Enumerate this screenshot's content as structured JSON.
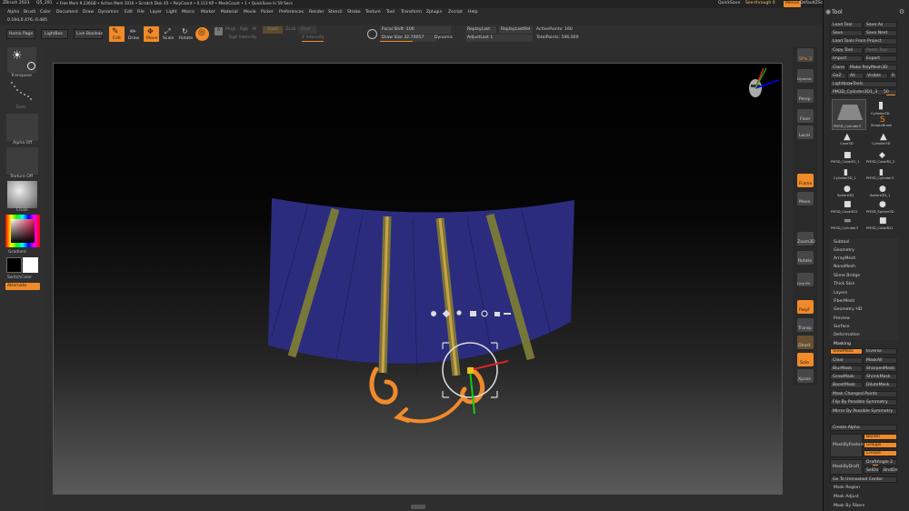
{
  "title_bar": {
    "app": "ZBrush 2023",
    "file": "Q5_291",
    "status": "• Free Mem 9.236GB • Active Mem 1016 • Scratch Disk 45 • PolyCount • 0.112 KP • MeshCount • 1 • QuickSave In 59 Secs",
    "quicksave": "QuickSave",
    "see_through": "See-through  0",
    "menus_btn": "Menus",
    "script": "DefaultZScript"
  },
  "menus": [
    "Alpha",
    "Brush",
    "Color",
    "Document",
    "Draw",
    "Dynamics",
    "Edit",
    "File",
    "Layer",
    "Light",
    "Macro",
    "Marker",
    "Material",
    "Movie",
    "Picker",
    "Preferences",
    "Render",
    "Stencil",
    "Stroke",
    "Texture",
    "Tool",
    "Transform",
    "Zplugin",
    "Zscript",
    "Help"
  ],
  "coords": "0.194,0.476,-0.485",
  "top_shelf": {
    "home_page": "Home Page",
    "lightbox": "LightBox",
    "live_boolean": "Live Boolean",
    "edit": "Edit",
    "draw": "Draw",
    "move": "Move",
    "scale": "Scale",
    "rotate": "Rotate",
    "a_badge": "A",
    "mrgb": "Mrgb",
    "rgb": "Rgb",
    "m": "M",
    "zadd": "Zadd",
    "zsub": "Zsub",
    "zcut": "Zcut",
    "rgb_intensity": "Rgb Intensity",
    "z_intensity": "Z Intensity",
    "focal_shift": "Focal Shift -100",
    "draw_size": "Draw Size 32.70057",
    "dynamic": "Dynamic",
    "replay_last": "ReplayLast",
    "replay_last_rel": "ReplayLastRel",
    "adjust_last": "AdjustLast 1",
    "active_points": "ActivePoints: 160",
    "total_points": "TotalPoints: 596,000"
  },
  "left_tray": {
    "brush_label": "Transpose",
    "stroke_label": "Dots",
    "alpha_label": "Alpha Off",
    "texture_label": "Texture Off",
    "material_label": "Chalk",
    "gradient_label": "Gradient",
    "switch_color": "SwitchColor",
    "alternate": "Alternate"
  },
  "right_shelf": [
    "SPix 3",
    "Dynamic",
    "Persp",
    "Floor",
    "Local",
    "Frame",
    "Move",
    "Zoom3D",
    "Rotate",
    "Line Fill",
    "PolyF",
    "Transp",
    "Ghost",
    "Solo",
    "Xpose",
    "Sym"
  ],
  "tool_palette": {
    "header": "Tool",
    "buttons": {
      "load_tool": "Load Tool",
      "save_as": "Save As",
      "save": "Save",
      "save_next": "Save Next",
      "load_from_project": "Load Tools From Project",
      "copy_tool": "Copy Tool",
      "paste_tool": "Paste Tool",
      "import": "Import",
      "export": "Export",
      "clone": "Clone",
      "make_polymesh": "Make PolyMesh3D",
      "goz": "GoZ",
      "all": "All",
      "visible": "Visible",
      "r": "R",
      "lightbox_tools": "Lightbox▸Tools"
    },
    "current_tool": "PM3D_Cylinder3D1_3",
    "current_count": "50",
    "thumbnails": [
      "PM3D_Cylinder3",
      "Cylinder3D",
      "SimpleBrush",
      "Cone3D",
      "Cylinder3D",
      "PM3D_Cube3D_1",
      "PM3D_Cube3D_2",
      "Cylinder3D_1",
      "PM3D_Cylinder3",
      "Sphere3D",
      "Sphere3D_1",
      "PM3D_Cube3D1",
      "PM3D_Sphere3D",
      "PM3D_Cylinder3",
      "PM3D_Cube3D1"
    ],
    "subpalettes": [
      "Subtool",
      "Geometry",
      "ArrayMesh",
      "NanoMesh",
      "Slime Bridge",
      "Thick Skin",
      "Layers",
      "FiberMesh",
      "Geometry HD",
      "Preview",
      "Surface",
      "Deformation",
      "Masking"
    ],
    "masking": {
      "view_mask": "ViewMask",
      "inverse": "Inverse",
      "clear": "Clear",
      "mask_all": "MaskAll",
      "blur_mask": "BlurMask",
      "sharpen_mask": "SharpenMask",
      "grow_mask": "GrowMask",
      "shrink_mask": "ShrinkMask",
      "boost_mask": "BoostMask",
      "dilute_mask": "DiluteMask",
      "mask_changed_points": "Mask Changed Points",
      "flip_by_possible_symmetry": "Flip By Possible Symmetry",
      "mirror_by_possible_symmetry": "Mirror By Possible Symmetry",
      "create_alpha": "Create Alpha",
      "mask_by_feature": "MaskByFeature",
      "border": "Border",
      "groups": "Groups",
      "crease": "Crease",
      "mask_by_draft": "MaskByDraft",
      "draft_angle": "DraftAngle 2",
      "sel_dir": "SelDir",
      "bndir": "BndDir",
      "go_to_unmasked_center": "Go To Unmasked Center",
      "mask_region": "Mask Region",
      "mask_adjust": "Mask Adjust",
      "mask_by_fibers": "Mask By Fibers"
    }
  },
  "colors": {
    "accent": "#f08a2a",
    "mesh": "#2c2c7e",
    "stripe": "#6b6c2f"
  }
}
